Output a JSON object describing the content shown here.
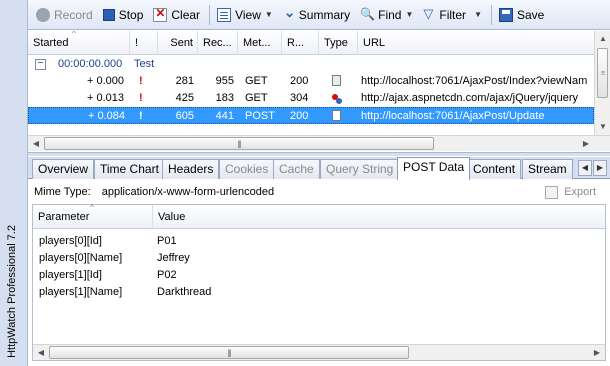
{
  "app": {
    "title": "HttpWatch Professional 7.2"
  },
  "toolbar": {
    "record": "Record",
    "stop": "Stop",
    "clear": "Clear",
    "view": "View",
    "summary": "Summary",
    "find": "Find",
    "filter": "Filter",
    "save": "Save"
  },
  "grid": {
    "columns": [
      "Started",
      "!",
      "Sent",
      "Rec...",
      "Met...",
      "R...",
      "Type",
      "URL"
    ],
    "group": {
      "time": "00:00:00.000",
      "name": "Test"
    },
    "rows": [
      {
        "started": "+ 0.000",
        "warn": "!",
        "sent": "281",
        "received": "955",
        "method": "GET",
        "result": "200",
        "type": "page",
        "url": "http://localhost:7061/AjaxPost/Index?viewNam"
      },
      {
        "started": "+ 0.013",
        "warn": "!",
        "sent": "425",
        "received": "183",
        "method": "GET",
        "result": "304",
        "type": "script",
        "url": "http://ajax.aspnetcdn.com/ajax/jQuery/jquery"
      },
      {
        "started": "+ 0.084",
        "warn": "!",
        "sent": "605",
        "received": "441",
        "method": "POST",
        "result": "200",
        "type": "blank",
        "url": "http://localhost:7061/AjaxPost/Update"
      }
    ]
  },
  "tabs": [
    "Overview",
    "Time Chart",
    "Headers",
    "Cookies",
    "Cache",
    "Query String",
    "POST Data",
    "Content",
    "Stream"
  ],
  "post": {
    "mime_label": "Mime Type:",
    "mime_value": "application/x-www-form-urlencoded",
    "export": "Export",
    "columns": [
      "Parameter",
      "Value"
    ],
    "rows": [
      {
        "param": "players[0][Id]",
        "value": "P01"
      },
      {
        "param": "players[0][Name]",
        "value": "Jeffrey"
      },
      {
        "param": "players[1][Id]",
        "value": "P02"
      },
      {
        "param": "players[1][Name]",
        "value": "Darkthread"
      }
    ]
  }
}
